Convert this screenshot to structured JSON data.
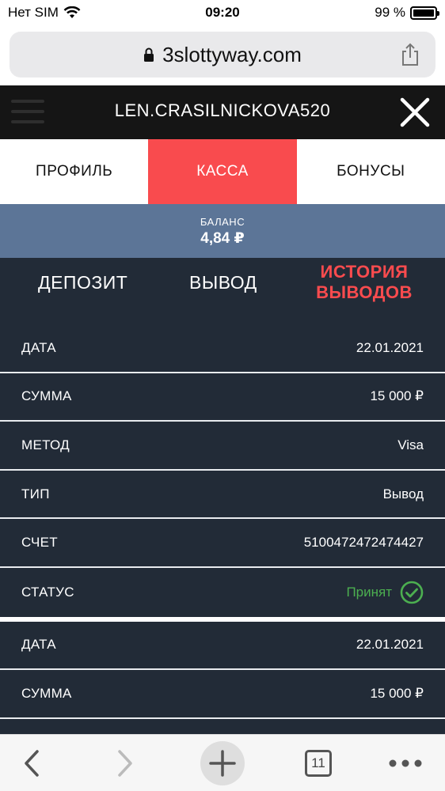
{
  "status_bar": {
    "carrier": "Нет SIM",
    "time": "09:20",
    "battery": "99 %"
  },
  "browser": {
    "url": "3slottyway.com"
  },
  "header": {
    "username": "LEN.CRASILNICKOVA520"
  },
  "tabs": [
    {
      "label": "ПРОФИЛЬ"
    },
    {
      "label": "КАССА"
    },
    {
      "label": "БОНУСЫ"
    }
  ],
  "balance": {
    "label": "БАЛАНС",
    "value": "4,84 ₽"
  },
  "subtabs": {
    "deposit": "ДЕПОЗИТ",
    "withdraw": "ВЫВОД",
    "history_line1": "ИСТОРИЯ",
    "history_line2": "ВЫВОДОВ"
  },
  "records": [
    {
      "date_label": "ДАТА",
      "date": "22.01.2021",
      "amount_label": "СУММА",
      "amount": "15 000 ₽",
      "method_label": "МЕТОД",
      "method": "Visa",
      "type_label": "ТИП",
      "type": "Вывод",
      "account_label": "СЧЕТ",
      "account": "5100472472474427",
      "status_label": "СТАТУС",
      "status": "Принят"
    },
    {
      "date_label": "ДАТА",
      "date": "22.01.2021",
      "amount_label": "СУММА",
      "amount": "15 000 ₽"
    }
  ],
  "toolbar": {
    "tabs_count": "11"
  },
  "colors": {
    "accent": "#f94b4e",
    "balance_bg": "#5c7597",
    "content_bg": "#222b37",
    "status_ok": "#4caf50"
  }
}
